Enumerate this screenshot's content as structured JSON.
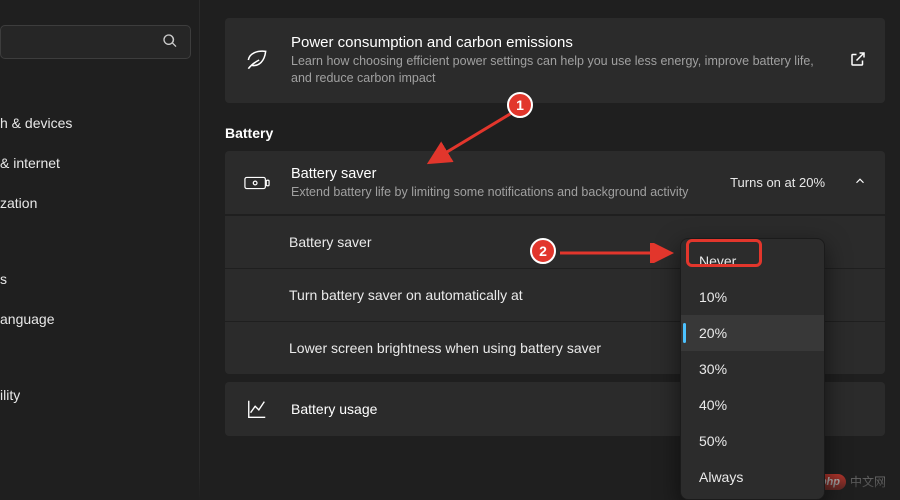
{
  "sidebar": {
    "search_placeholder": "",
    "items": [
      {
        "label": "h & devices"
      },
      {
        "label": "& internet"
      },
      {
        "label": "zation"
      },
      {
        "label": "s"
      },
      {
        "label": "anguage"
      },
      {
        "label": "ility"
      }
    ]
  },
  "power_card": {
    "title": "Power consumption and carbon emissions",
    "desc": "Learn how choosing efficient power settings can help you use less energy, improve battery life, and reduce carbon impact"
  },
  "section_label": "Battery",
  "battery_saver": {
    "title": "Battery saver",
    "desc": "Extend battery life by limiting some notifications and background activity",
    "status": "Turns on at 20%",
    "sub_rows": [
      "Battery saver",
      "Turn battery saver on automatically at",
      "Lower screen brightness when using battery saver"
    ]
  },
  "battery_usage": {
    "title": "Battery usage"
  },
  "dropdown": {
    "options": [
      "Never",
      "10%",
      "20%",
      "30%",
      "40%",
      "50%",
      "Always"
    ],
    "selected_index": 2
  },
  "annotations": {
    "badge1": "1",
    "badge2": "2"
  },
  "watermark": {
    "badge": "php",
    "text": "中文网"
  }
}
